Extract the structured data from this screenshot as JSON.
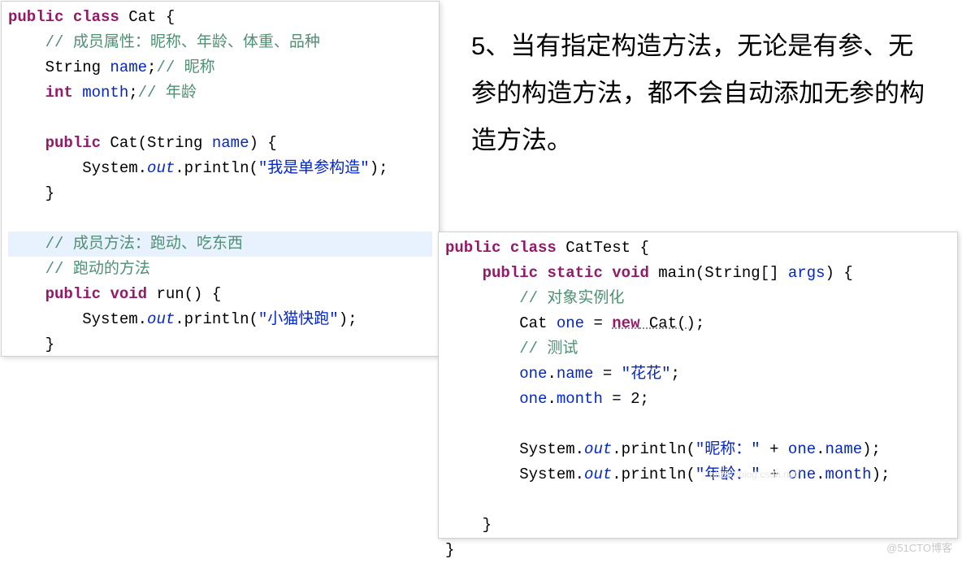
{
  "note": "5、当有指定构造方法，无论是有参、无参的构造方法，都不会自动添加无参的构造方法。",
  "code_left": {
    "l1_kw1": "public",
    "l1_kw2": "class",
    "l1_cls": "Cat",
    "l1_brace": " {",
    "l2_comment": "// 成员属性：昵称、年龄、体重、品种",
    "l3_type": "String",
    "l3_name": " name",
    "l3_semi": ";",
    "l3_comment": "// 昵称",
    "l4_kw": "int",
    "l4_name": " month",
    "l4_semi": ";",
    "l4_comment": "// 年龄",
    "l6_kw": "public",
    "l6_ctor": " Cat(String ",
    "l6_param": "name",
    "l6_close": ") {",
    "l7_sys": "System.",
    "l7_out": "out",
    "l7_print": ".println(",
    "l7_str": "\"我是单参构造\"",
    "l7_end": ");",
    "l8_brace": "}",
    "l10_comment": "// 成员方法：跑动、吃东西",
    "l11_comment": "// 跑动的方法",
    "l12_kw1": "public",
    "l12_kw2": "void",
    "l12_name": " run() {",
    "l13_sys": "System.",
    "l13_out": "out",
    "l13_print": ".println(",
    "l13_str": "\"小猫快跑\"",
    "l13_end": ");",
    "l14_brace": "}"
  },
  "code_right": {
    "l1_kw1": "public",
    "l1_kw2": "class",
    "l1_cls": "CatTest",
    "l1_brace": " {",
    "l2_kw1": "public",
    "l2_kw2": "static",
    "l2_kw3": "void",
    "l2_main": " main(String[] ",
    "l2_args": "args",
    "l2_close": ") {",
    "l3_comment": "// 对象实例化",
    "l4_type": "Cat ",
    "l4_var": "one",
    "l4_eq": " = ",
    "l4_new": "new",
    "l4_ctor": " Cat()",
    "l4_semi": ";",
    "l5_comment": "// 测试",
    "l6_var": "one",
    "l6_dot": ".",
    "l6_field": "name",
    "l6_eq": " = ",
    "l6_str": "\"花花\"",
    "l6_semi": ";",
    "l7_var": "one",
    "l7_dot": ".",
    "l7_field": "month",
    "l7_eq": " = ",
    "l7_val": "2",
    "l7_semi": ";",
    "l9_sys": "System.",
    "l9_out": "out",
    "l9_print": ".println(",
    "l9_str": "\"昵称：\"",
    "l9_plus": " + ",
    "l9_var": "one",
    "l9_dot": ".",
    "l9_field": "name",
    "l9_end": ");",
    "l10_sys": "System.",
    "l10_out": "out",
    "l10_print": ".println(",
    "l10_str": "\"年龄：\"",
    "l10_plus": " + ",
    "l10_var": "one",
    "l10_dot": ".",
    "l10_field": "month",
    "l10_end": ");",
    "l12_brace": "}",
    "l13_brace": "}"
  },
  "watermark": "@51CTO博客",
  "watermark2": "https://blog.csdn.net/"
}
